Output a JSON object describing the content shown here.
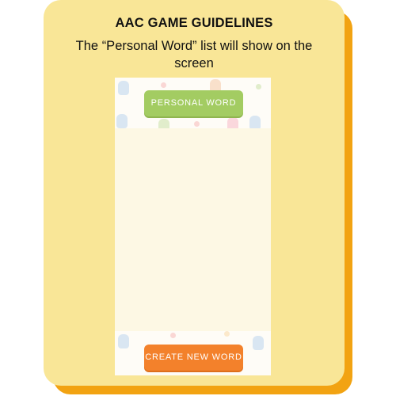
{
  "guide": {
    "title": "AAC GAME GUIDELINES",
    "description": "The “Personal Word” list will show on the screen"
  },
  "phone": {
    "personal_word_button": "PERSONAL WORD",
    "create_new_word_button": "CREATE NEW WORD",
    "background_pattern": "pastel-cat-doodles"
  },
  "colors": {
    "card": "#f9e697",
    "card_shadow": "#f2a312",
    "personal_button": "#a3cc62",
    "create_button": "#f3812b",
    "screen_background": "#fdf8e4"
  }
}
